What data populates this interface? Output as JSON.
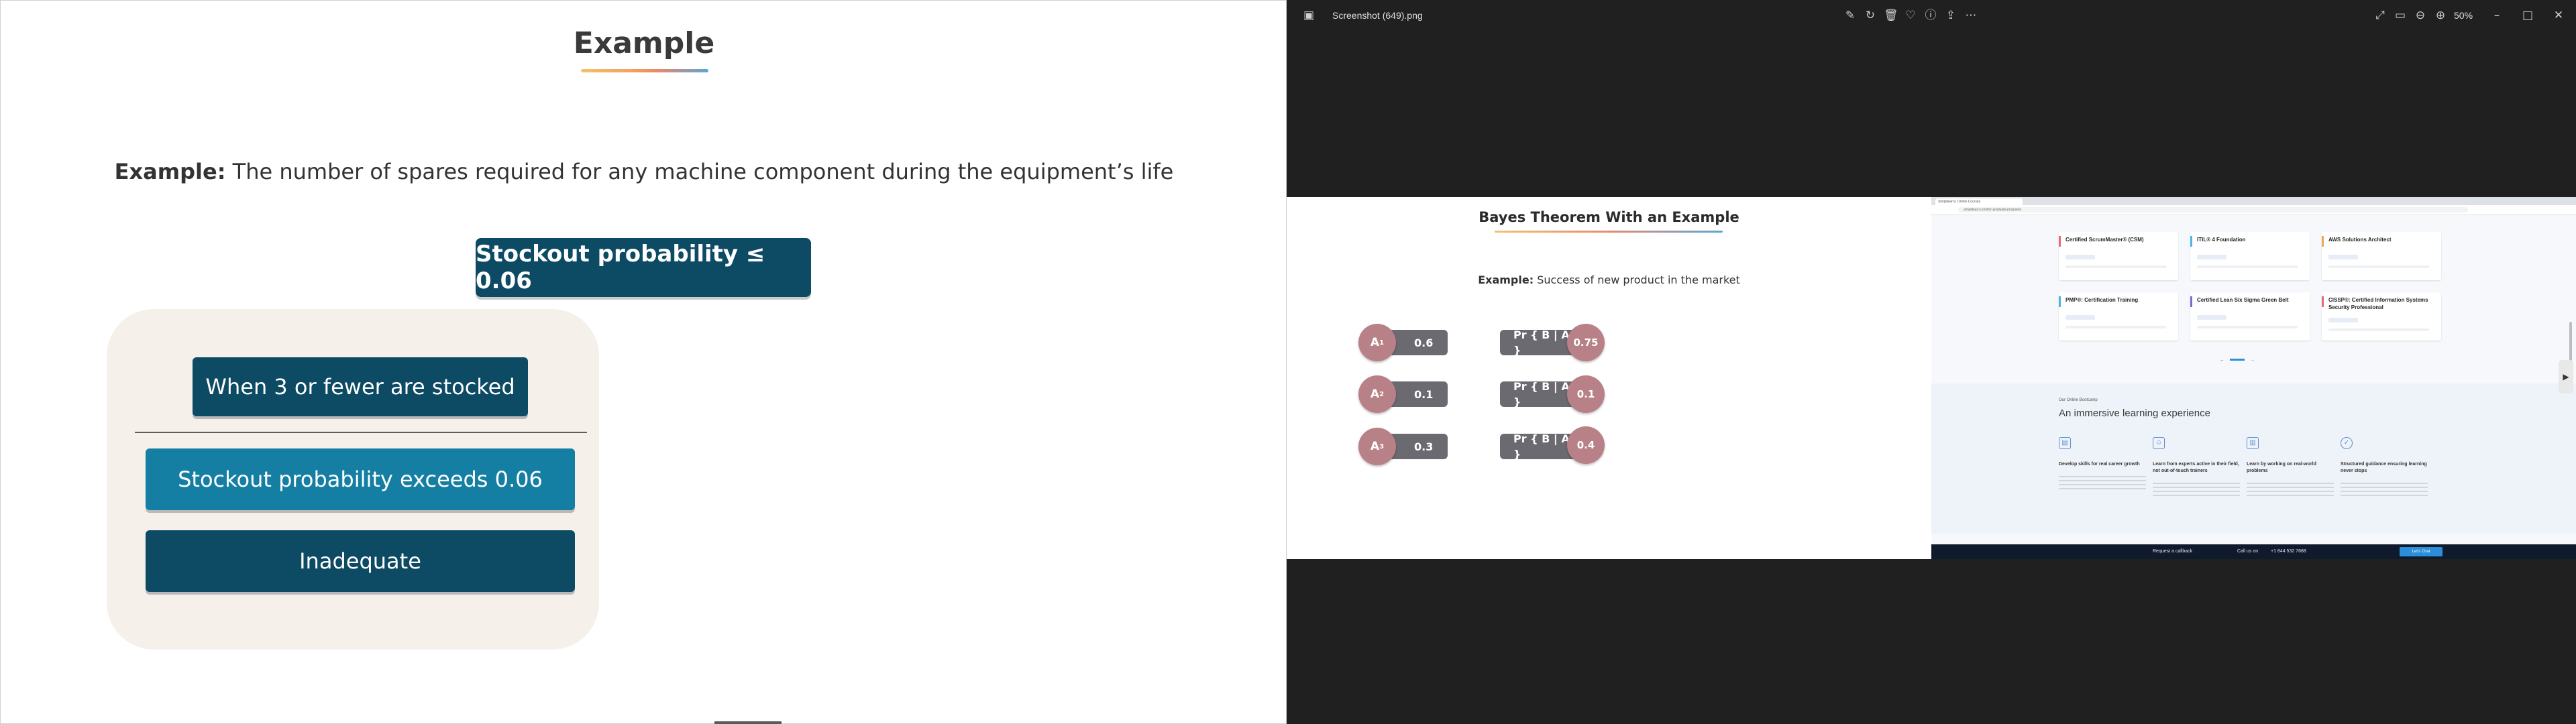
{
  "slide": {
    "title": "Example",
    "example_prefix": "Example:",
    "example_text": "The number of spares required for any machine component during the equipment’s life",
    "stockout_label": "Stockout probability ≤ 0.06",
    "card": {
      "item1": "When 3 or fewer are stocked",
      "item2": "Stockout probability exceeds 0.06",
      "item3": "Inadequate"
    }
  },
  "viewer": {
    "file_name": "Screenshot (649).png",
    "zoom": "50%",
    "toolbar_icons": [
      "edit-icon",
      "rotate-icon",
      "delete-icon",
      "favorite-icon",
      "info-icon",
      "share-icon",
      "more-icon"
    ],
    "right_icons": [
      "fullscreen-icon",
      "fit-icon",
      "zoom-out-icon",
      "zoom-in-icon"
    ],
    "window_icons": [
      "minimize-icon",
      "maximize-icon",
      "close-icon"
    ]
  },
  "bayes": {
    "title": "Bayes Theorem With an Example",
    "example_prefix": "Example:",
    "example_text": "Success of new product in the market",
    "priors": [
      {
        "label": "A",
        "sub": "1",
        "value": "0.6"
      },
      {
        "label": "A",
        "sub": "2",
        "value": "0.1"
      },
      {
        "label": "A",
        "sub": "3",
        "value": "0.3"
      }
    ],
    "likelihoods": [
      {
        "label": "Pr { B | A",
        "sub": "1",
        "close": " }",
        "value": "0.75"
      },
      {
        "label": "Pr { B | A",
        "sub": "2",
        "close": " }",
        "value": "0.1"
      },
      {
        "label": "Pr { B | A",
        "sub": "3",
        "close": " }",
        "value": "0.4"
      }
    ]
  },
  "browser": {
    "tab_title": "Simplilearn | Online Courses",
    "url": "simplilearn.com/for-graduate-programs",
    "courses": [
      {
        "title": "Certified ScrumMaster® (CSM)",
        "color": "#e86a7a"
      },
      {
        "title": "ITIL® 4 Foundation",
        "color": "#4bb4e6"
      },
      {
        "title": "AWS Solutions Architect",
        "color": "#f2a65a"
      },
      {
        "title": "PMP®: Certification Training",
        "color": "#4bb4e6"
      },
      {
        "title": "Certified Lean Six Sigma Green Belt",
        "color": "#7a6ad8"
      },
      {
        "title": "CISSP®: Certified Information Systems Security Professional",
        "color": "#e86a7a"
      }
    ],
    "immersive_kicker": "Our Online Bootcamp",
    "immersive_heading": "An immersive learning experience",
    "features": [
      {
        "title": "Develop skills for real career growth"
      },
      {
        "title": "Learn from experts active in their field, not out-of-touch trainers"
      },
      {
        "title": "Learn by working on real-world problems"
      },
      {
        "title": "Structured guidance ensuring learning never stops"
      }
    ],
    "footer": {
      "callback": "Request a callback",
      "call": "Call us on",
      "phone": "+1 844 532 7688",
      "chat": "Let's Chat"
    }
  }
}
